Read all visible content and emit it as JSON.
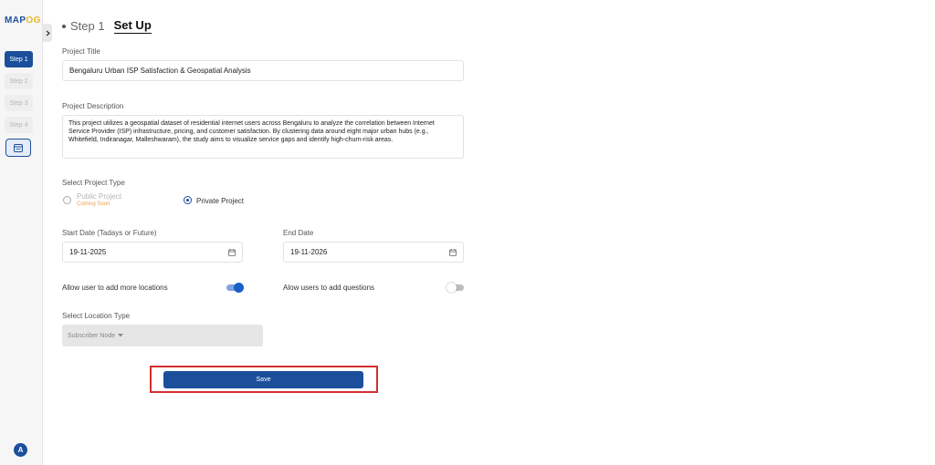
{
  "sidebar": {
    "logo_part1": "MAP",
    "logo_part2": "OG",
    "steps": [
      {
        "label": "Step 1",
        "active": true
      },
      {
        "label": "Step 2",
        "active": false
      },
      {
        "label": "Step 3",
        "active": false
      },
      {
        "label": "Step 4",
        "active": false
      }
    ],
    "avatar_initial": "A"
  },
  "header": {
    "step": "Step 1",
    "title": "Set Up"
  },
  "form": {
    "project_title_label": "Project Title",
    "project_title_value": "Bengaluru Urban ISP Satisfaction & Geospatial Analysis",
    "project_description_label": "Project Description",
    "project_description_value": "This project utilizes a geospatial dataset of residential internet users across Bengaluru to analyze the correlation between Internet Service Provider (ISP) infrastructure, pricing, and customer satisfaction. By clustering data around eight major urban hubs (e.g., Whitefield, Indiranagar, Malleshwaram), the study aims to visualize service gaps and identify high-churn-risk areas.",
    "project_type_label": "Select Project Type",
    "public_label": "Public Project",
    "public_note": "Coming Soon",
    "private_label": "Private Project",
    "start_date_label": "Start Date (Tadays or Future)",
    "start_date_value": "19-11-2025",
    "end_date_label": "End Date",
    "end_date_value": "19-11-2026",
    "allow_locations_label": "Allow user to add more locations",
    "allow_locations_on": true,
    "allow_questions_label": "Alow users to add questions",
    "allow_questions_on": false,
    "location_type_label": "Select Location Type",
    "location_type_value": "Subscriber Node",
    "save_label": "Save"
  },
  "colors": {
    "primary": "#1b4f9c",
    "highlight": "#d32f2f",
    "coming_soon": "#e8a04c",
    "logo_accent": "#e8b923"
  }
}
